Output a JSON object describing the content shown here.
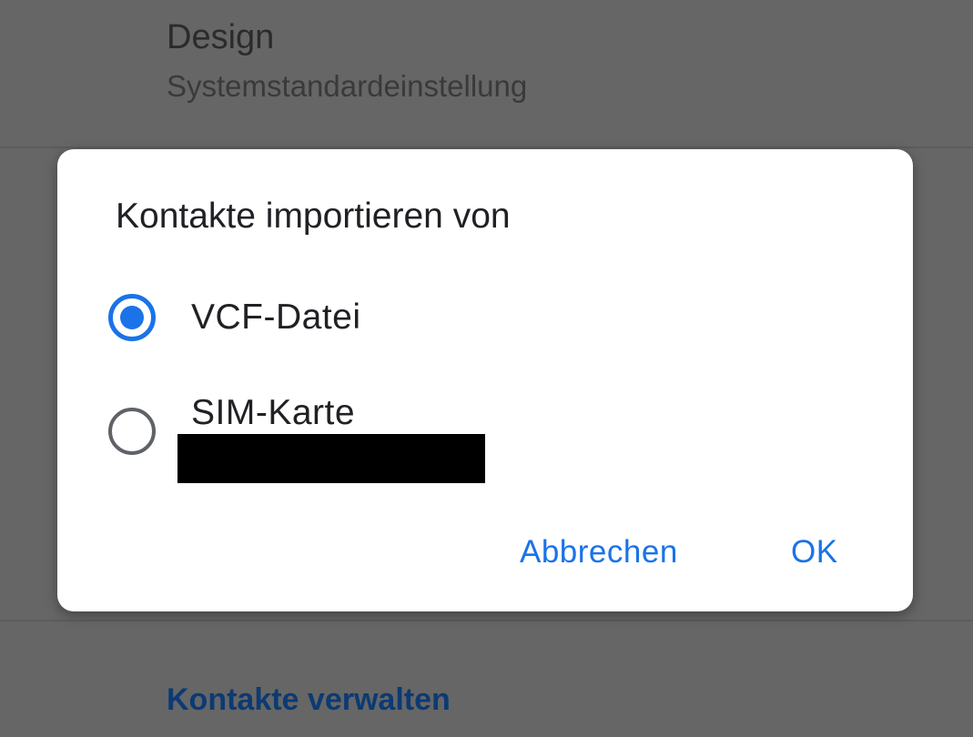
{
  "background": {
    "design_title": "Design",
    "design_subtitle": "Systemstandardeinstellung",
    "manage_contacts_link": "Kontakte verwalten"
  },
  "dialog": {
    "title": "Kontakte importieren von",
    "options": [
      {
        "label": "VCF-Datei",
        "selected": true
      },
      {
        "label": "SIM-Karte",
        "selected": false
      }
    ],
    "cancel_label": "Abbrechen",
    "ok_label": "OK"
  },
  "colors": {
    "accent": "#1a73e8",
    "scrim": "#666666",
    "dialog_background": "#ffffff",
    "unselected_radio": "#5f6368",
    "link_on_scrim": "#0c3a73"
  },
  "icons": {
    "selected_radio": "radio-checked-icon",
    "unselected_radio": "radio-unchecked-icon"
  }
}
